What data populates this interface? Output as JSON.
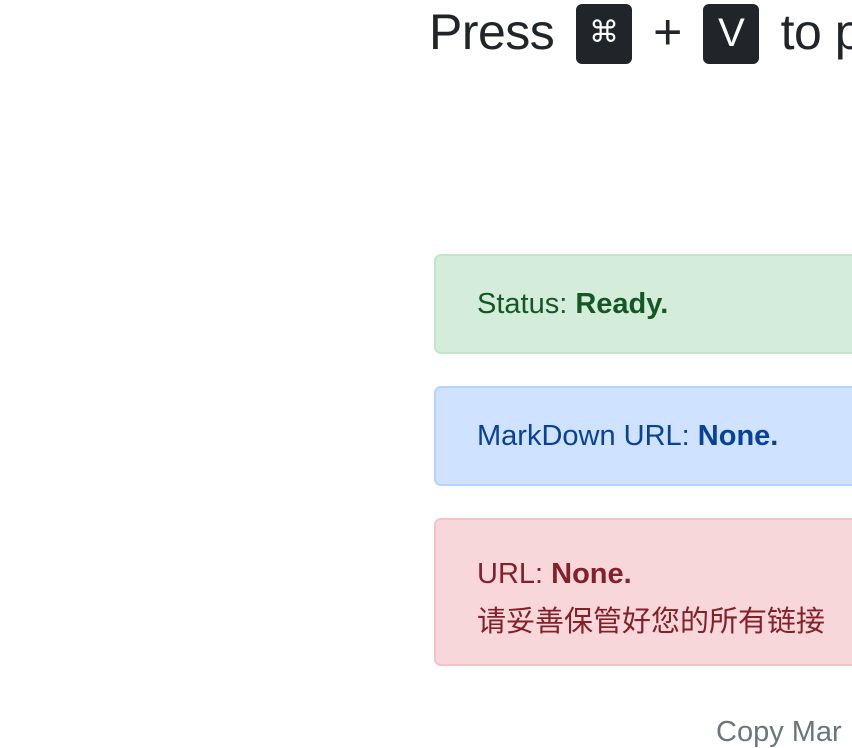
{
  "heading": {
    "press": "Press",
    "cmd_key": "⌘",
    "plus": "+",
    "v_key": "V",
    "rest": "to p"
  },
  "status": {
    "label": "Status:",
    "value": "Ready."
  },
  "markdown_url": {
    "label": "MarkDown URL:",
    "value": "None."
  },
  "url": {
    "label": "URL:",
    "value": "None.",
    "notice": "请妥善保管好您的所有链接"
  },
  "footer": {
    "text": "Copy Mar"
  },
  "colors": {
    "success_bg": "#d4edda",
    "success_text": "#155724",
    "info_bg": "#cfe2ff",
    "info_text": "#084298",
    "danger_bg": "#f8d7da",
    "danger_text": "#842029",
    "kbd_bg": "#212529"
  }
}
